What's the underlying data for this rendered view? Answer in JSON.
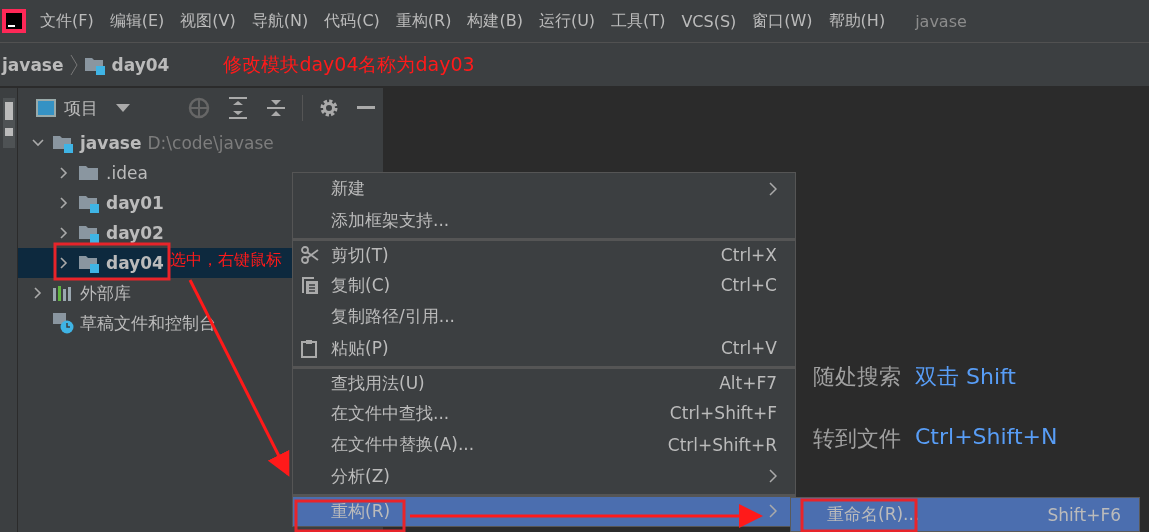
{
  "menu_bar": {
    "items": [
      "文件(F)",
      "编辑(E)",
      "视图(V)",
      "导航(N)",
      "代码(C)",
      "重构(R)",
      "构建(B)",
      "运行(U)",
      "工具(T)",
      "VCS(S)",
      "窗口(W)",
      "帮助(H)"
    ],
    "project_name": "javase"
  },
  "breadcrumb": {
    "items": [
      "javase",
      "day04"
    ],
    "note": "修改模块day04名称为day03"
  },
  "project_panel": {
    "title": "项目",
    "tree": [
      {
        "kind": "module",
        "label": "javase",
        "path": "D:\\code\\javase",
        "expanded": true,
        "selected": false,
        "children": [
          {
            "kind": "folder",
            "label": ".idea",
            "expanded": false,
            "selected": false
          },
          {
            "kind": "module",
            "label": "day01",
            "expanded": false,
            "selected": false
          },
          {
            "kind": "module",
            "label": "day02",
            "expanded": false,
            "selected": false
          },
          {
            "kind": "module",
            "label": "day04",
            "expanded": false,
            "selected": true,
            "note": "选中，右键鼠标"
          }
        ]
      },
      {
        "kind": "library",
        "label": "外部库",
        "expanded": false,
        "selected": false
      },
      {
        "kind": "scratch",
        "label": "草稿文件和控制台",
        "selected": false
      }
    ]
  },
  "hints": [
    {
      "label": "随处搜索",
      "shortcut": "双击 Shift"
    },
    {
      "label": "转到文件",
      "shortcut": "Ctrl+Shift+N"
    }
  ],
  "context_menu": {
    "items": [
      {
        "kind": "plain",
        "label": "新建",
        "submenu": true,
        "separator_before": false,
        "selected": false
      },
      {
        "kind": "plain",
        "label": "添加框架支持...",
        "submenu": false,
        "separator_before": false,
        "selected": false
      },
      {
        "kind": "cut",
        "label": "剪切(T)",
        "shortcut": "Ctrl+X",
        "submenu": false,
        "separator_before": true,
        "selected": false
      },
      {
        "kind": "copy",
        "label": "复制(C)",
        "shortcut": "Ctrl+C",
        "submenu": false,
        "separator_before": false,
        "selected": false
      },
      {
        "kind": "plain",
        "label": "复制路径/引用...",
        "submenu": false,
        "separator_before": false,
        "selected": false
      },
      {
        "kind": "paste",
        "label": "粘贴(P)",
        "shortcut": "Ctrl+V",
        "submenu": false,
        "separator_before": false,
        "selected": false
      },
      {
        "kind": "plain",
        "label": "查找用法(U)",
        "shortcut": "Alt+F7",
        "submenu": false,
        "separator_before": true,
        "selected": false
      },
      {
        "kind": "plain",
        "label": "在文件中查找...",
        "shortcut": "Ctrl+Shift+F",
        "submenu": false,
        "separator_before": false,
        "selected": false
      },
      {
        "kind": "plain",
        "label": "在文件中替换(A)...",
        "shortcut": "Ctrl+Shift+R",
        "submenu": false,
        "separator_before": false,
        "selected": false
      },
      {
        "kind": "plain",
        "label": "分析(Z)",
        "submenu": true,
        "separator_before": false,
        "selected": false
      },
      {
        "kind": "plain",
        "label": "重构(R)",
        "submenu": true,
        "separator_before": true,
        "selected": true
      }
    ]
  },
  "submenu": {
    "items": [
      {
        "label": "重命名(R)...",
        "shortcut": "Shift+F6",
        "selected": true
      }
    ]
  }
}
